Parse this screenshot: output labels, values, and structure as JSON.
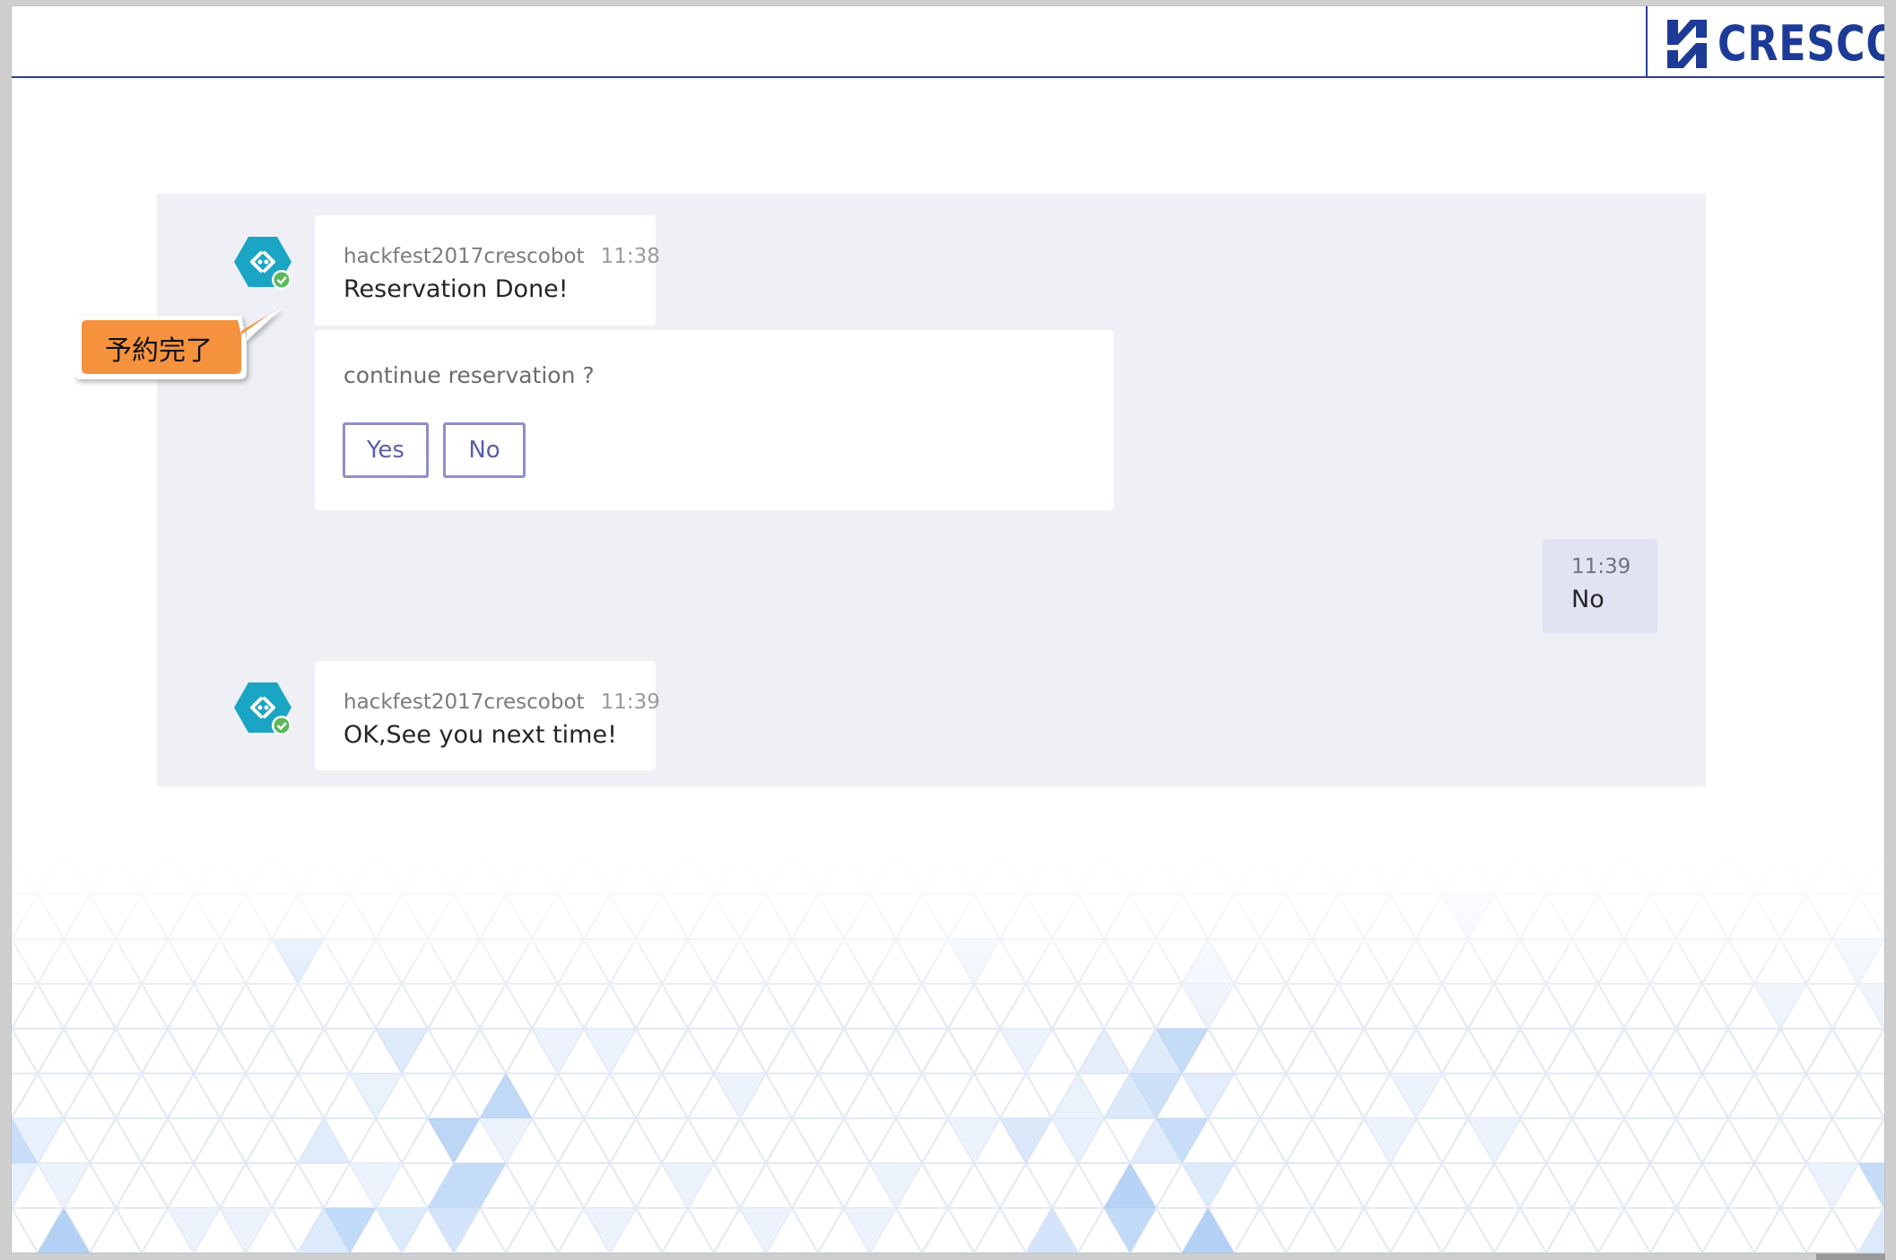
{
  "header": {
    "logo_text": "CRESCO",
    "brand_color": "#1d3b96"
  },
  "callout": {
    "label": "予約完了",
    "color": "#f5923e"
  },
  "chat": {
    "messages": [
      {
        "sender": "hackfest2017crescobot",
        "time": "11:38",
        "text": "Reservation Done!"
      },
      {
        "card_prompt": "continue reservation ?",
        "buttons": [
          "Yes",
          "No"
        ]
      },
      {
        "time": "11:39",
        "text": "No"
      },
      {
        "sender": "hackfest2017crescobot",
        "time": "11:39",
        "text": "OK,See you next time!"
      }
    ]
  },
  "colors": {
    "panel_bg": "#eef0f5",
    "user_bubble_bg": "#e1e2f2",
    "button_border": "#8d8fc7",
    "bot_avatar": "#1ba5c4",
    "status_ok": "#5cb85c"
  }
}
